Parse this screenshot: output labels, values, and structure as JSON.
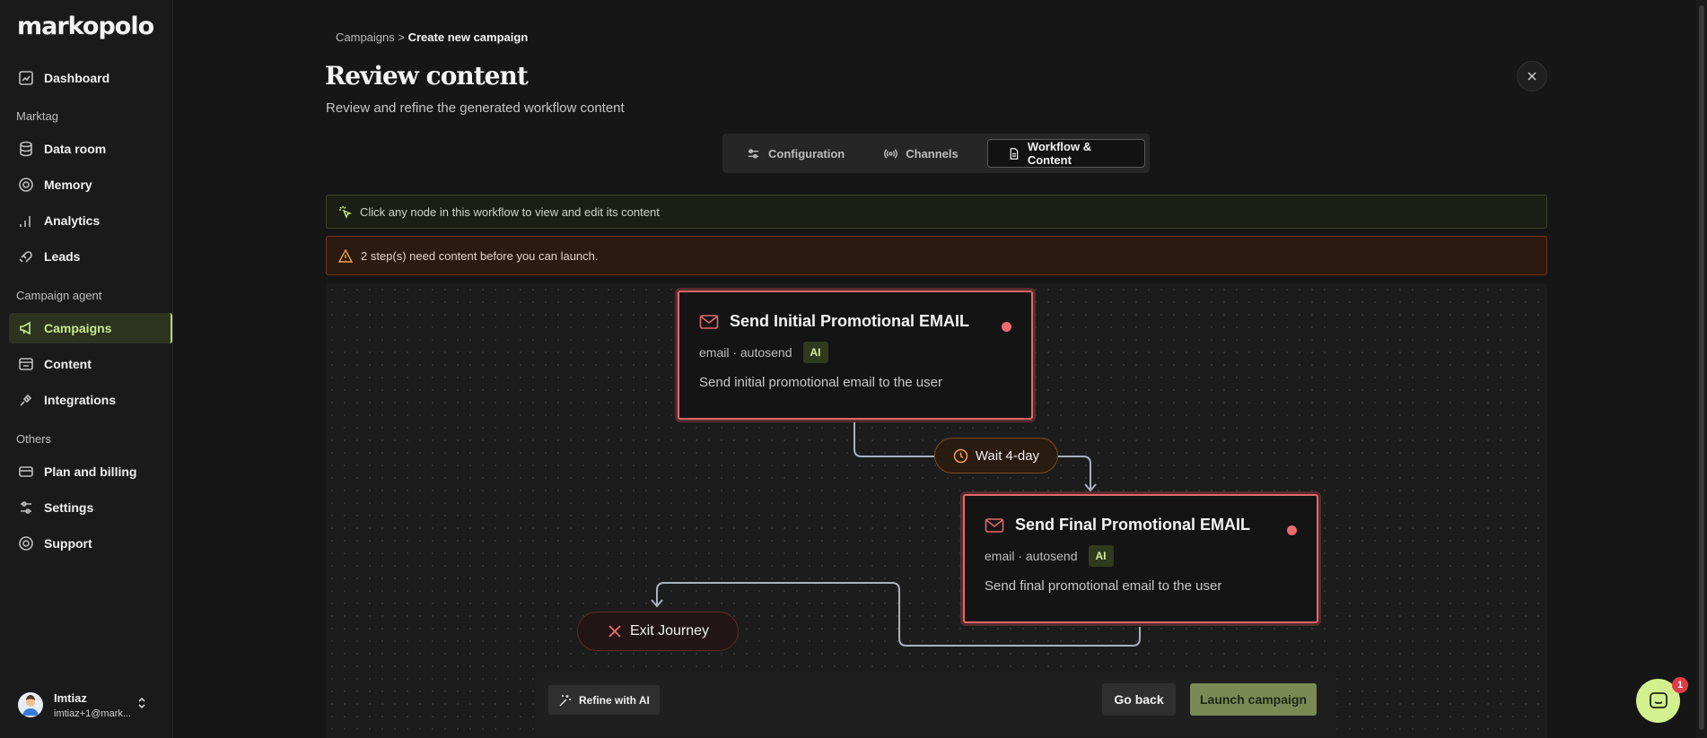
{
  "app": {
    "logo": "markopolo"
  },
  "sidebar": {
    "dashboard": "Dashboard",
    "section_marktag": "Marktag",
    "data_room": "Data room",
    "memory": "Memory",
    "analytics": "Analytics",
    "leads": "Leads",
    "section_campaign_agent": "Campaign agent",
    "campaigns": "Campaigns",
    "content": "Content",
    "integrations": "Integrations",
    "section_others": "Others",
    "plan_billing": "Plan and billing",
    "settings": "Settings",
    "support": "Support",
    "user_name": "Imtiaz",
    "user_email": "imtiaz+1@mark..."
  },
  "header": {
    "breadcrumb_root": "Campaigns",
    "breadcrumb_sep": ">",
    "breadcrumb_current": "Create new campaign",
    "title": "Review content",
    "subtitle": "Review and refine the generated workflow content"
  },
  "tabs": {
    "configuration": "Configuration",
    "channels": "Channels",
    "workflow": "Workflow & Content"
  },
  "banners": {
    "info": "Click any node in this workflow to view and edit its content",
    "warning": "2 step(s) need content before you can launch."
  },
  "workflow": {
    "node1": {
      "title": "Send Initial Promotional EMAIL",
      "meta": "email · autosend",
      "badge": "AI",
      "desc": "Send initial promotional email to the user"
    },
    "wait": "Wait 4-day",
    "node2": {
      "title": "Send Final Promotional EMAIL",
      "meta": "email · autosend",
      "badge": "AI",
      "desc": "Send final promotional email to the user"
    },
    "exit": "Exit Journey"
  },
  "actions": {
    "refine": "Refine with AI",
    "go_back": "Go back",
    "launch": "Launch campaign"
  },
  "chat": {
    "badge": "1"
  },
  "colors": {
    "accent": "#c9e98a",
    "node_border": "#e0686c",
    "launch": "#7b8a55"
  }
}
